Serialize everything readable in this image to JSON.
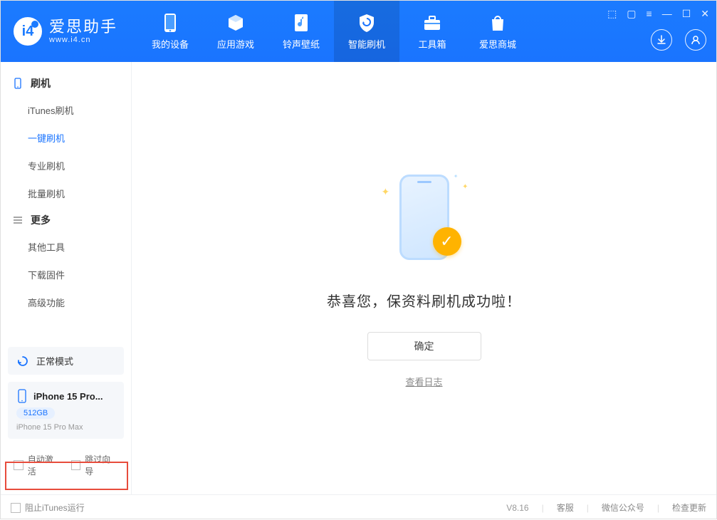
{
  "brand": {
    "title": "爱思助手",
    "subtitle": "www.i4.cn"
  },
  "nav": {
    "items": [
      {
        "label": "我的设备"
      },
      {
        "label": "应用游戏"
      },
      {
        "label": "铃声壁纸"
      },
      {
        "label": "智能刷机"
      },
      {
        "label": "工具箱"
      },
      {
        "label": "爱思商城"
      }
    ]
  },
  "sidebar": {
    "group1": {
      "title": "刷机",
      "items": [
        "iTunes刷机",
        "一键刷机",
        "专业刷机",
        "批量刷机"
      ]
    },
    "group2": {
      "title": "更多",
      "items": [
        "其他工具",
        "下载固件",
        "高级功能"
      ]
    },
    "status": "正常模式",
    "device": {
      "name": "iPhone 15 Pro...",
      "storage": "512GB",
      "model": "iPhone 15 Pro Max"
    },
    "checks": {
      "auto_activate": "自动激活",
      "skip_guide": "跳过向导"
    }
  },
  "main": {
    "success_text": "恭喜您，保资料刷机成功啦！",
    "ok_button": "确定",
    "view_log": "查看日志"
  },
  "footer": {
    "block_itunes": "阻止iTunes运行",
    "version": "V8.16",
    "links": [
      "客服",
      "微信公众号",
      "检查更新"
    ]
  }
}
